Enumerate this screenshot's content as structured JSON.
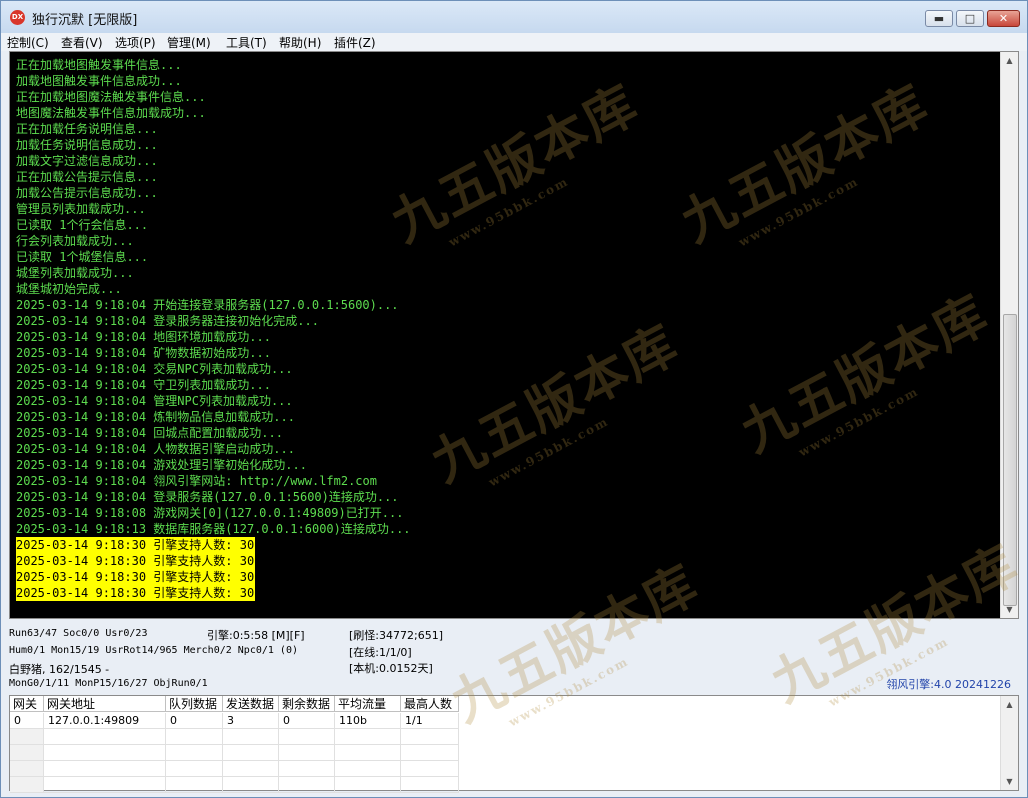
{
  "window": {
    "title": "独行沉默 [无限版]",
    "app_icon_label": "DX",
    "controls": {
      "minimize": "▬",
      "maximize": "□",
      "close": "✕"
    }
  },
  "menu": [
    "控制(C)",
    "查看(V)",
    "选项(P)",
    "管理(M)",
    "工具(T)",
    "帮助(H)",
    "插件(Z)"
  ],
  "console": {
    "lines": [
      "正在加载地图触发事件信息...",
      "加载地图触发事件信息成功...",
      "正在加载地图魔法触发事件信息...",
      "地图魔法触发事件信息加载成功...",
      "正在加载任务说明信息...",
      "加载任务说明信息成功...",
      "加载文字过滤信息成功...",
      "正在加载公告提示信息...",
      "加载公告提示信息成功...",
      "管理员列表加载成功...",
      "已读取 1个行会信息...",
      "行会列表加载成功...",
      "已读取 1个城堡信息...",
      "城堡列表加载成功...",
      "城堡城初始完成...",
      "2025-03-14 9:18:04 开始连接登录服务器(127.0.0.1:5600)...",
      "2025-03-14 9:18:04 登录服务器连接初始化完成...",
      "2025-03-14 9:18:04 地图环境加载成功...",
      "2025-03-14 9:18:04 矿物数据初始成功...",
      "2025-03-14 9:18:04 交易NPC列表加载成功...",
      "2025-03-14 9:18:04 守卫列表加载成功...",
      "2025-03-14 9:18:04 管理NPC列表加载成功...",
      "2025-03-14 9:18:04 炼制物品信息加载成功...",
      "2025-03-14 9:18:04 回城点配置加载成功...",
      "2025-03-14 9:18:04 人物数据引擎启动成功...",
      "2025-03-14 9:18:04 游戏处理引擎初始化成功...",
      "2025-03-14 9:18:04 翎风引擎网站: http://www.lfm2.com",
      "2025-03-14 9:18:04 登录服务器(127.0.0.1:5600)连接成功...",
      "2025-03-14 9:18:08 游戏网关[0](127.0.0.1:49809)已打开...",
      "2025-03-14 9:18:13 数据库服务器(127.0.0.1:6000)连接成功..."
    ],
    "highlighted_lines": [
      "2025-03-14 9:18:30 引擎支持人数: 30",
      "2025-03-14 9:18:30 引擎支持人数: 30",
      "2025-03-14 9:18:30 引擎支持人数: 30",
      "2025-03-14 9:18:30 引擎支持人数: 30"
    ],
    "text_color": "#5ddc4f",
    "highlight_color": "#ffff00"
  },
  "status": {
    "run": "Run63/47 Soc0/0 Usr0/23",
    "engine": "引擎:0:5:58 [M][F]",
    "refresh": "[刷怪:34772;651]",
    "hum": "Hum0/1 Mon15/19 UsrRot14/965 Merch0/2 Npc0/1 (0)",
    "online": "[在线:1/1/0]",
    "monster": "白野猪, 162/1545 -",
    "local": "[本机:0.0152天]",
    "mon": "MonG0/1/11 MonP15/16/27 ObjRun0/1",
    "version": "翎风引擎:4.0 20241226"
  },
  "gate_table": {
    "headers": [
      "网关",
      "网关地址",
      "队列数据",
      "发送数据",
      "剩余数据",
      "平均流量",
      "最高人数"
    ],
    "rows": [
      [
        "0",
        "127.0.0.1:49809",
        "0",
        "3",
        "0",
        "110b",
        "1/1"
      ]
    ]
  },
  "watermark": {
    "brand": "九五版本库",
    "url": "www.95bbk.com"
  }
}
